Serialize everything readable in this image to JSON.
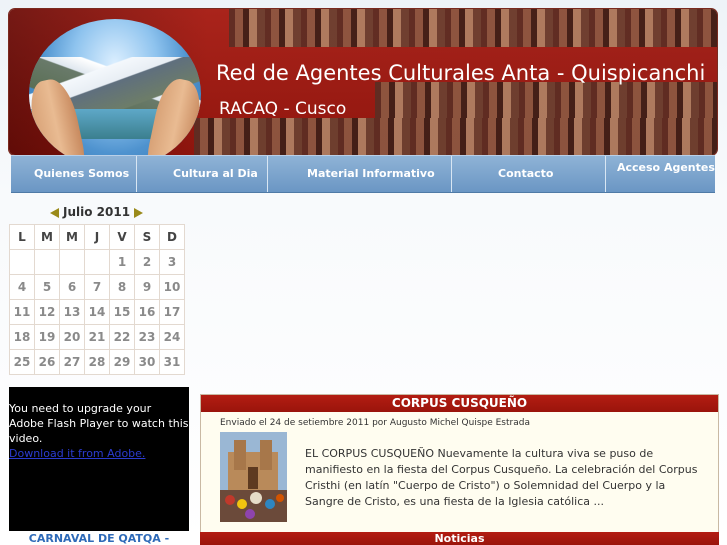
{
  "header": {
    "title": "Red de Agentes Culturales Anta - Quispicanchi",
    "subtitle": "RACAQ - Cusco"
  },
  "nav": {
    "items": [
      {
        "label": "Quienes Somos"
      },
      {
        "label": "Cultura al Dia"
      },
      {
        "label": "Material Informativo"
      },
      {
        "label": "Contacto"
      },
      {
        "label": "Acceso Agentes"
      }
    ]
  },
  "calendar": {
    "month_label": "Julio 2011",
    "weekdays": [
      "L",
      "M",
      "M",
      "J",
      "V",
      "S",
      "D"
    ],
    "weeks": [
      [
        "",
        "",
        "",
        "",
        "1",
        "2",
        "3"
      ],
      [
        "4",
        "5",
        "6",
        "7",
        "8",
        "9",
        "10"
      ],
      [
        "11",
        "12",
        "13",
        "14",
        "15",
        "16",
        "17"
      ],
      [
        "18",
        "19",
        "20",
        "21",
        "22",
        "23",
        "24"
      ],
      [
        "25",
        "26",
        "27",
        "28",
        "29",
        "30",
        "31"
      ]
    ]
  },
  "flash": {
    "message": "You need to upgrade your Adobe Flash Player to watch this video.",
    "link_text": "Download it from Adobe."
  },
  "sidebar": {
    "carnaval_label": "CARNAVAL DE QATQA -"
  },
  "article": {
    "title": "CORPUS CUSQUEÑO",
    "meta": "Enviado el 24 de setiembre 2011 por Augusto Michel Quispe Estrada",
    "body": "EL CORPUS CUSQUEÑO   Nuevamente la cultura viva se puso de manifiesto en la fiesta del Corpus Cusqueño. La celebración del Corpus Cristhi (en latín \"Cuerpo de Cristo\") o Solemnidad del Cuerpo y la Sangre de Cristo, es una fiesta de la Iglesia católica ..."
  },
  "noticias": {
    "label": "Noticias"
  },
  "colors": {
    "header_red": "#a5180f",
    "nav_blue": "#6b96c4",
    "accent_link": "#2e6ab8"
  }
}
